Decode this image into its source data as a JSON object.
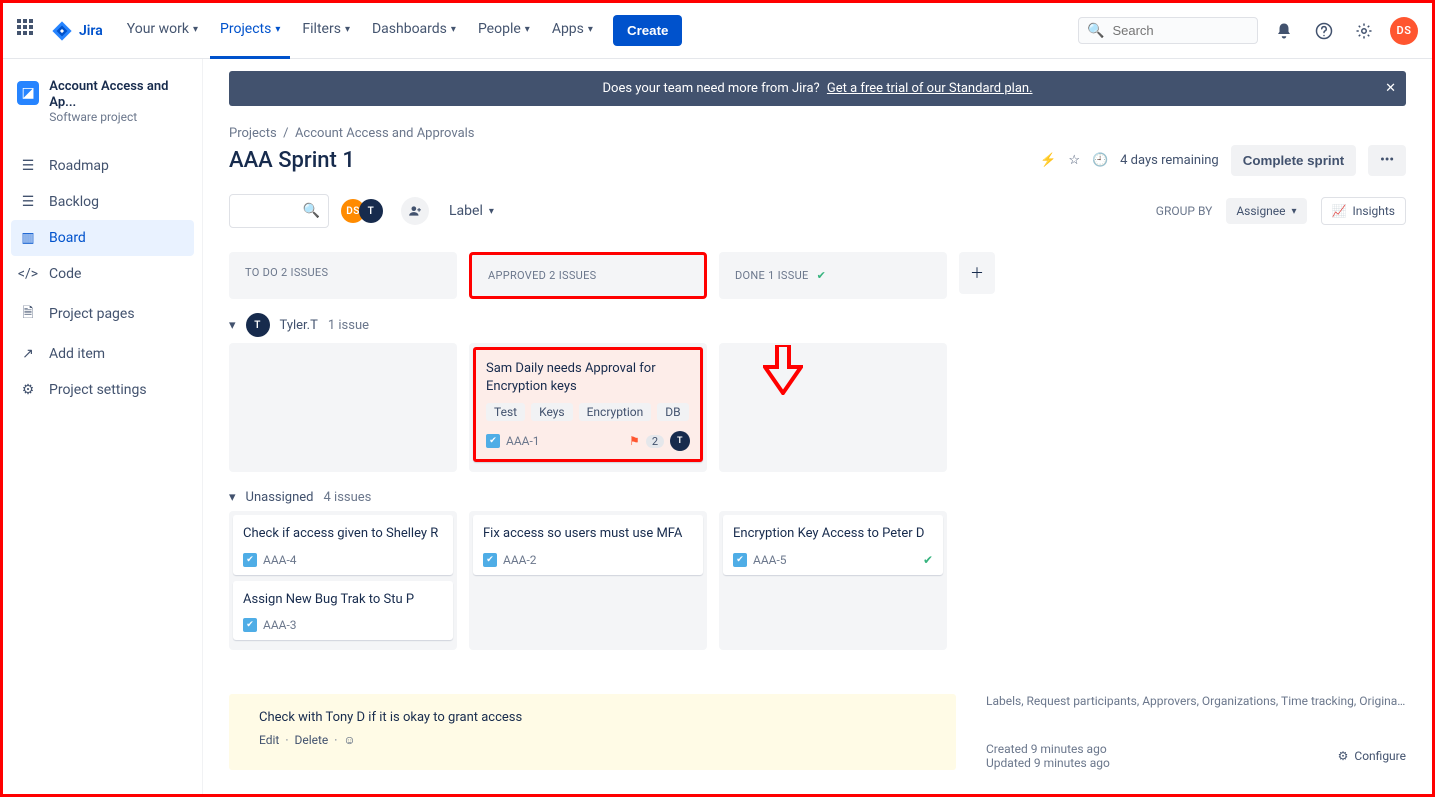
{
  "brand": "Jira",
  "nav": {
    "your_work": "Your work",
    "projects": "Projects",
    "filters": "Filters",
    "dashboards": "Dashboards",
    "people": "People",
    "apps": "Apps",
    "create": "Create"
  },
  "search_placeholder": "Search",
  "user_initials": "DS",
  "project": {
    "name": "Account Access and Ap...",
    "subtitle": "Software project"
  },
  "sidebar": {
    "items": [
      {
        "label": "Roadmap"
      },
      {
        "label": "Backlog"
      },
      {
        "label": "Board"
      },
      {
        "label": "Code"
      },
      {
        "label": "Project pages"
      },
      {
        "label": "Add item"
      },
      {
        "label": "Project settings"
      }
    ]
  },
  "banner": {
    "text": "Does your team need more from Jira?",
    "link": "Get a free trial of our Standard plan."
  },
  "breadcrumb": {
    "root": "Projects",
    "current": "Account Access and Approvals"
  },
  "page_title": "AAA Sprint 1",
  "head_right": {
    "remaining": "4 days remaining",
    "complete": "Complete sprint"
  },
  "controls": {
    "label": "Label",
    "group_by_label": "GROUP BY",
    "group_by_value": "Assignee",
    "insights": "Insights"
  },
  "swimlanes": [
    {
      "name": "Tyler.T",
      "count_label": "1 issue",
      "avatar": "T",
      "avatar_bg": "navy"
    },
    {
      "name": "Unassigned",
      "count_label": "4 issues"
    }
  ],
  "columns": {
    "todo": "TO DO 2 ISSUES",
    "approved": "APPROVED 2 ISSUES",
    "done": "DONE 1 ISSUE"
  },
  "cards": {
    "tyler_approved": {
      "title": "Sam Daily needs Approval for Encryption keys",
      "tags": [
        "Test",
        "Keys",
        "Encryption",
        "DB"
      ],
      "key": "AAA-1",
      "points": "2",
      "assignee": "T"
    },
    "u_todo": [
      {
        "title": "Check if access given to Shelley R",
        "key": "AAA-4"
      },
      {
        "title": "Assign New Bug Trak to Stu P",
        "key": "AAA-3"
      }
    ],
    "u_approved": [
      {
        "title": "Fix access so users must use MFA",
        "key": "AAA-2"
      }
    ],
    "u_done": [
      {
        "title": "Encryption Key Access to Peter D",
        "key": "AAA-5"
      }
    ]
  },
  "detail": {
    "comment_text": "Check with Tony D if it is okay to grant access",
    "edit": "Edit",
    "delete": "Delete",
    "meta_line": "Labels, Request participants, Approvers, Organizations, Time tracking, Original est...",
    "created": "Created 9 minutes ago",
    "updated": "Updated 9 minutes ago",
    "configure": "Configure"
  }
}
